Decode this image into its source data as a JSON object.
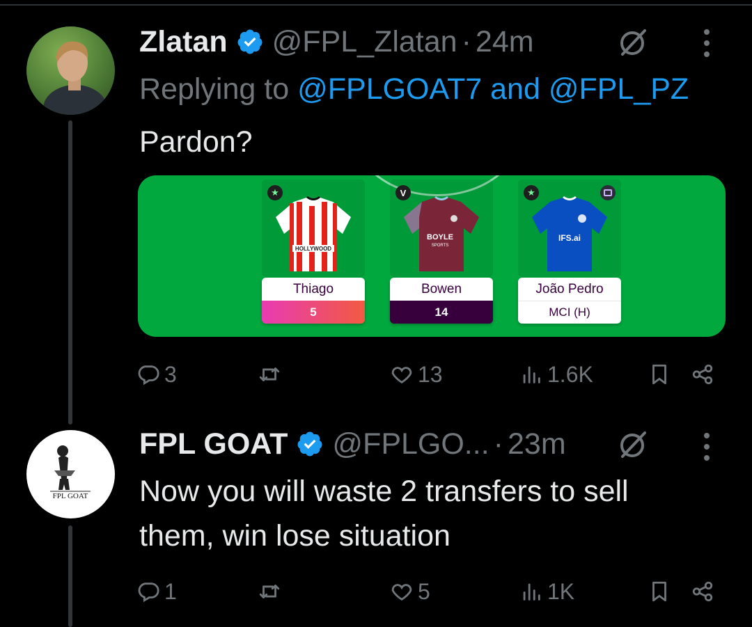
{
  "tweets": [
    {
      "name": "Zlatan",
      "handle": "@FPL_Zlatan",
      "separator": "·",
      "time": "24m",
      "replying_prefix": "Replying to",
      "reply_mentions": [
        "@FPLGOAT7",
        "and",
        "@FPL_PZ"
      ],
      "text": "Pardon?",
      "card": {
        "players": [
          {
            "badge": "★",
            "name": "Thiago",
            "value": "5",
            "style": "pink"
          },
          {
            "badge": "V",
            "name": "Bowen",
            "value": "14",
            "style": "purple"
          },
          {
            "badge": "★",
            "name": "João Pedro",
            "value": "MCI (H)",
            "style": "white"
          }
        ],
        "shirt_texts": [
          "HOLLYWOOD",
          "BOYLE",
          "SPORTS",
          "IFS.ai"
        ]
      },
      "metrics": {
        "replies": "3",
        "retweets": "",
        "likes": "13",
        "views": "1.6K"
      }
    },
    {
      "name": "FPL GOAT",
      "handle": "@FPLGO...",
      "separator": "·",
      "time": "23m",
      "avatar_text": "FPL GOAT",
      "text_lines": [
        "Now you will waste 2 transfers to sell",
        "them, win lose situation"
      ],
      "metrics": {
        "replies": "1",
        "retweets": "",
        "likes": "5",
        "views": "1K"
      }
    }
  ],
  "colors": {
    "accent": "#1d9bf0",
    "muted": "#71767b",
    "card_green": "#00a83e",
    "fpl_purple": "#37003c"
  },
  "icons": [
    "verified-badge-icon",
    "grok-icon",
    "more-icon",
    "reply-icon",
    "retweet-icon",
    "like-icon",
    "views-icon",
    "bookmark-icon",
    "share-icon"
  ]
}
